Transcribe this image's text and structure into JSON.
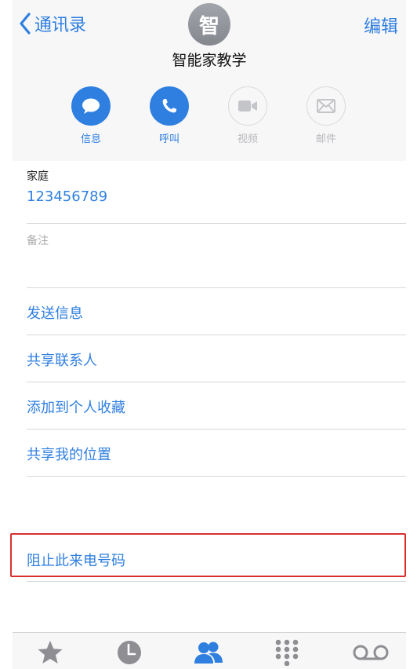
{
  "header": {
    "back_label": "通讯录",
    "edit_label": "编辑",
    "avatar_initial": "智",
    "contact_name": "智能家教学",
    "background": "#f7f7f8"
  },
  "actions": [
    {
      "label": "信息",
      "icon": "message-icon",
      "enabled": true
    },
    {
      "label": "呼叫",
      "icon": "phone-icon",
      "enabled": true
    },
    {
      "label": "视频",
      "icon": "video-icon",
      "enabled": false
    },
    {
      "label": "邮件",
      "icon": "mail-icon",
      "enabled": false
    }
  ],
  "phone": {
    "label": "家庭",
    "number": "123456789"
  },
  "notes": {
    "label": "备注"
  },
  "links": {
    "send_message": "发送信息",
    "share_contact": "共享联系人",
    "add_favorite": "添加到个人收藏",
    "share_location": "共享我的位置",
    "block_caller": "阻止此来电号码"
  },
  "tabbar": [
    {
      "icon": "star-icon",
      "active": false
    },
    {
      "icon": "clock-icon",
      "active": false
    },
    {
      "icon": "contacts-icon",
      "active": true
    },
    {
      "icon": "keypad-icon",
      "active": false
    },
    {
      "icon": "voicemail-icon",
      "active": false
    }
  ],
  "colors": {
    "accent": "#2f7fe0",
    "highlight": "#d9302f",
    "inactive": "#8e8e93"
  }
}
